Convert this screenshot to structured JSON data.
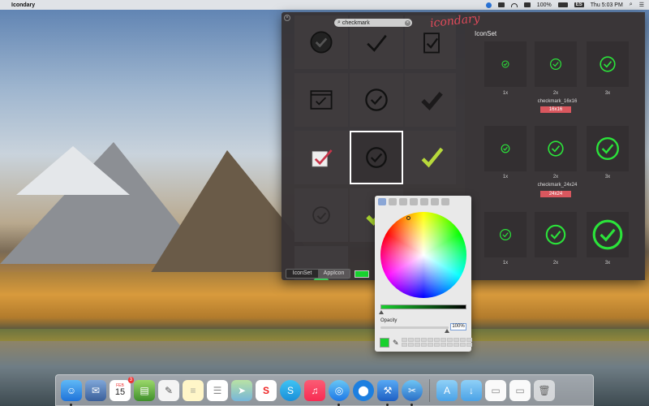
{
  "menubar": {
    "app_name": "Icondary",
    "battery": "100%",
    "input_flag": "ES",
    "clock": "Thu 5:03 PM"
  },
  "panel": {
    "brand": "icondary",
    "search": {
      "value": "checkmark",
      "clear_glyph": "×"
    },
    "segments": {
      "iconset": "IconSet",
      "appicon": "AppIcon"
    }
  },
  "iconset": {
    "title": "IconSet",
    "groups": [
      {
        "name": "checkmark_16x16",
        "badge": "16x16",
        "labels": [
          "1x",
          "2x",
          "3x"
        ]
      },
      {
        "name": "checkmark_24x24",
        "badge": "24x24",
        "labels": [
          "1x",
          "2x",
          "3x"
        ]
      },
      {
        "name": "",
        "badge": "",
        "labels": [
          "1x",
          "2x",
          "3x"
        ]
      }
    ]
  },
  "picker": {
    "opacity_label": "Opacity",
    "opacity_value": "100%",
    "selected_color": "#17d12e"
  },
  "accent": {
    "green": "#17d12e",
    "brand_red": "#e04a5a"
  },
  "dock": {
    "calendar_month": "FEB",
    "calendar_day": "15",
    "calendar_badge": "3"
  }
}
